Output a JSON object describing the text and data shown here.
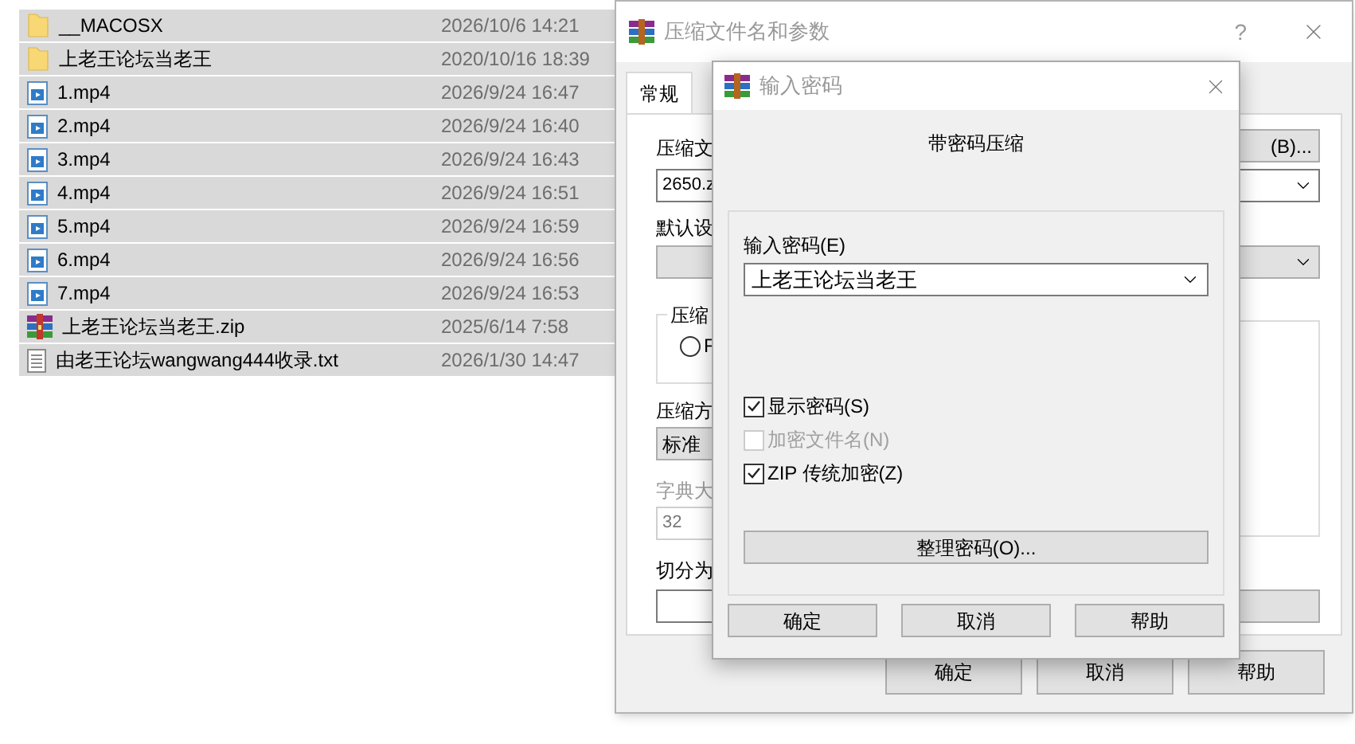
{
  "files": [
    {
      "name": "__MACOSX",
      "modified": "2026/10/6 14:21",
      "kind": "folder"
    },
    {
      "name": "上老王论坛当老王",
      "modified": "2020/10/16 18:39",
      "kind": "folder"
    },
    {
      "name": "1.mp4",
      "modified": "2026/9/24 16:47",
      "kind": "video"
    },
    {
      "name": "2.mp4",
      "modified": "2026/9/24 16:40",
      "kind": "video"
    },
    {
      "name": "3.mp4",
      "modified": "2026/9/24 16:43",
      "kind": "video"
    },
    {
      "name": "4.mp4",
      "modified": "2026/9/24 16:51",
      "kind": "video"
    },
    {
      "name": "5.mp4",
      "modified": "2026/9/24 16:59",
      "kind": "video"
    },
    {
      "name": "6.mp4",
      "modified": "2026/9/24 16:56",
      "kind": "video"
    },
    {
      "name": "7.mp4",
      "modified": "2026/9/24 16:53",
      "kind": "video"
    },
    {
      "name": "上老王论坛当老王.zip",
      "modified": "2025/6/14 7:58",
      "kind": "archive"
    },
    {
      "name": "由老王论坛wangwang444收录.txt",
      "modified": "2026/1/30 14:47",
      "kind": "text"
    }
  ],
  "archive_dialog": {
    "title": "压缩文件名和参数",
    "help": "?",
    "tabs": [
      {
        "label": "常规",
        "selected": true
      }
    ],
    "archive_name_label": "压缩文",
    "browse_button": "(B)...",
    "archive_name": "2650.z",
    "profile_label": "默认设",
    "format_group_label": "压缩",
    "format_option": {
      "label": "F",
      "selected": false
    },
    "method_label": "压缩方",
    "method": "标准",
    "dictionary_label": "字典大",
    "dictionary": "32",
    "split_label": "切分为",
    "buttons": [
      "确定",
      "取消",
      "帮助"
    ]
  },
  "password_dialog": {
    "title": "输入密码",
    "heading": "带密码压缩",
    "password_label": "输入密码(E)",
    "password": "上老王论坛当老王",
    "options": [
      {
        "label": "显示密码(S)",
        "checked": true,
        "disabled": false
      },
      {
        "label": "加密文件名(N)",
        "checked": false,
        "disabled": true
      },
      {
        "label": "ZIP 传统加密(Z)",
        "checked": true,
        "disabled": false
      }
    ],
    "organize_button": "整理密码(O)...",
    "buttons": [
      "确定",
      "取消",
      "帮助"
    ]
  }
}
